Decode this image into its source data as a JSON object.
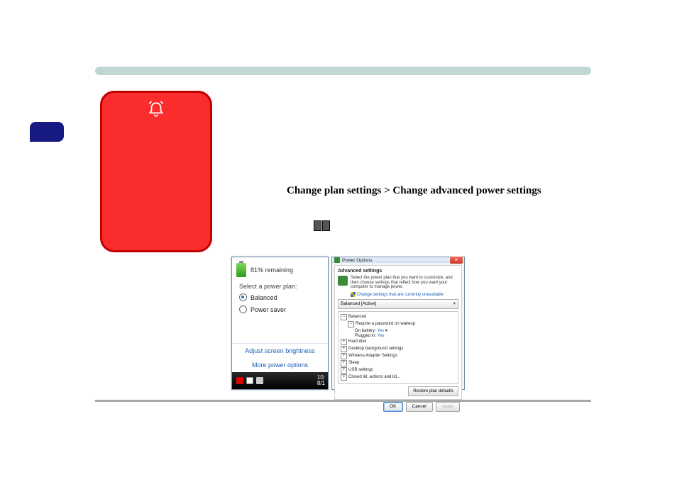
{
  "breadcrumb": "Change plan settings > Change advanced power settings",
  "battery_popup": {
    "remaining": "81% remaining",
    "select_label": "Select a power plan:",
    "plans": [
      {
        "label": "Balanced",
        "selected": true
      },
      {
        "label": "Power saver",
        "selected": false
      }
    ],
    "links": {
      "brightness": "Adjust screen brightness",
      "more": "More power options"
    },
    "clock": {
      "time": "10:",
      "date": "8/1"
    }
  },
  "power_dialog": {
    "title": "Power Options",
    "subtitle": "Advanced settings",
    "description": "Select the power plan that you want to customize, and then choose settings that reflect how you want your computer to manage power.",
    "unavailable_link": "Change settings that are currently unavailable",
    "combo_value": "Balanced [Active]",
    "tree": {
      "root": "Balanced",
      "req_pw": "Require a password on wakeup",
      "on_batt": "On battery:",
      "on_batt_val": "Yes",
      "plugged": "Plugged in:",
      "plugged_val": "Yes",
      "hard_disk": "Hard disk",
      "desktop_bg": "Desktop background settings",
      "wireless": "Wireless Adapter Settings",
      "sleep": "Sleep",
      "usb": "USB settings",
      "closed": "Closed lid, actions and lid..."
    },
    "restore": "Restore plan defaults",
    "buttons": {
      "ok": "OK",
      "cancel": "Cancel",
      "apply": "Apply"
    }
  }
}
